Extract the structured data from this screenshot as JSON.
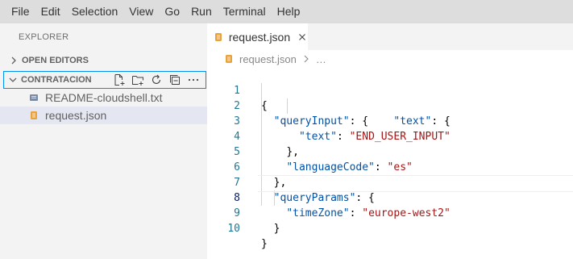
{
  "menubar": {
    "items": [
      "File",
      "Edit",
      "Selection",
      "View",
      "Go",
      "Run",
      "Terminal",
      "Help"
    ]
  },
  "sidebar": {
    "title": "EXPLORER",
    "open_editors": "OPEN EDITORS",
    "folder": "CONTRATACION",
    "actions": [
      "new-file-icon",
      "new-folder-icon",
      "refresh-icon",
      "collapse-all-icon",
      "more-icon"
    ],
    "files": [
      {
        "name": "README-cloudshell.txt",
        "icon": "text-file-icon"
      },
      {
        "name": "request.json",
        "icon": "json-file-icon"
      }
    ]
  },
  "editor": {
    "tab": {
      "label": "request.json",
      "icon": "json-file-icon"
    },
    "breadcrumb": {
      "file": "request.json",
      "tail": "…"
    },
    "current_line": 8,
    "lines": [
      {
        "no": "1"
      },
      {
        "no": "2"
      },
      {
        "no": "3"
      },
      {
        "no": "4"
      },
      {
        "no": "5"
      },
      {
        "no": "6"
      },
      {
        "no": "7"
      },
      {
        "no": "8"
      },
      {
        "no": "9"
      },
      {
        "no": "10"
      }
    ],
    "tokens": {
      "l1_brace": "{",
      "l2_key": "\"queryInput\"",
      "l2_punc": ": {    ",
      "l2_key2": "\"text\"",
      "l2_punc2": ": {",
      "l3_key": "\"text\"",
      "l3_punc": ": ",
      "l3_val": "\"END_USER_INPUT\"",
      "l4_punc": "},",
      "l5_key": "\"languageCode\"",
      "l5_punc": ": ",
      "l5_val": "\"es\"",
      "l6_punc": "},",
      "l7_key": "\"queryParams\"",
      "l7_punc": ": {",
      "l8_key": "\"timeZone\"",
      "l8_punc": ": ",
      "l8_val": "\"europe-west2\"",
      "l9_punc": "}",
      "l10_brace": "}"
    }
  },
  "colors": {
    "menubar_bg": "#dddddd",
    "sidebar_bg": "#f3f3f3",
    "selected_row_bg": "#e4e6f1",
    "focus_border": "#0090f1",
    "json_icon": "#e8a33d",
    "line_number": "#237893",
    "key": "#0451a5",
    "string": "#a31515"
  }
}
